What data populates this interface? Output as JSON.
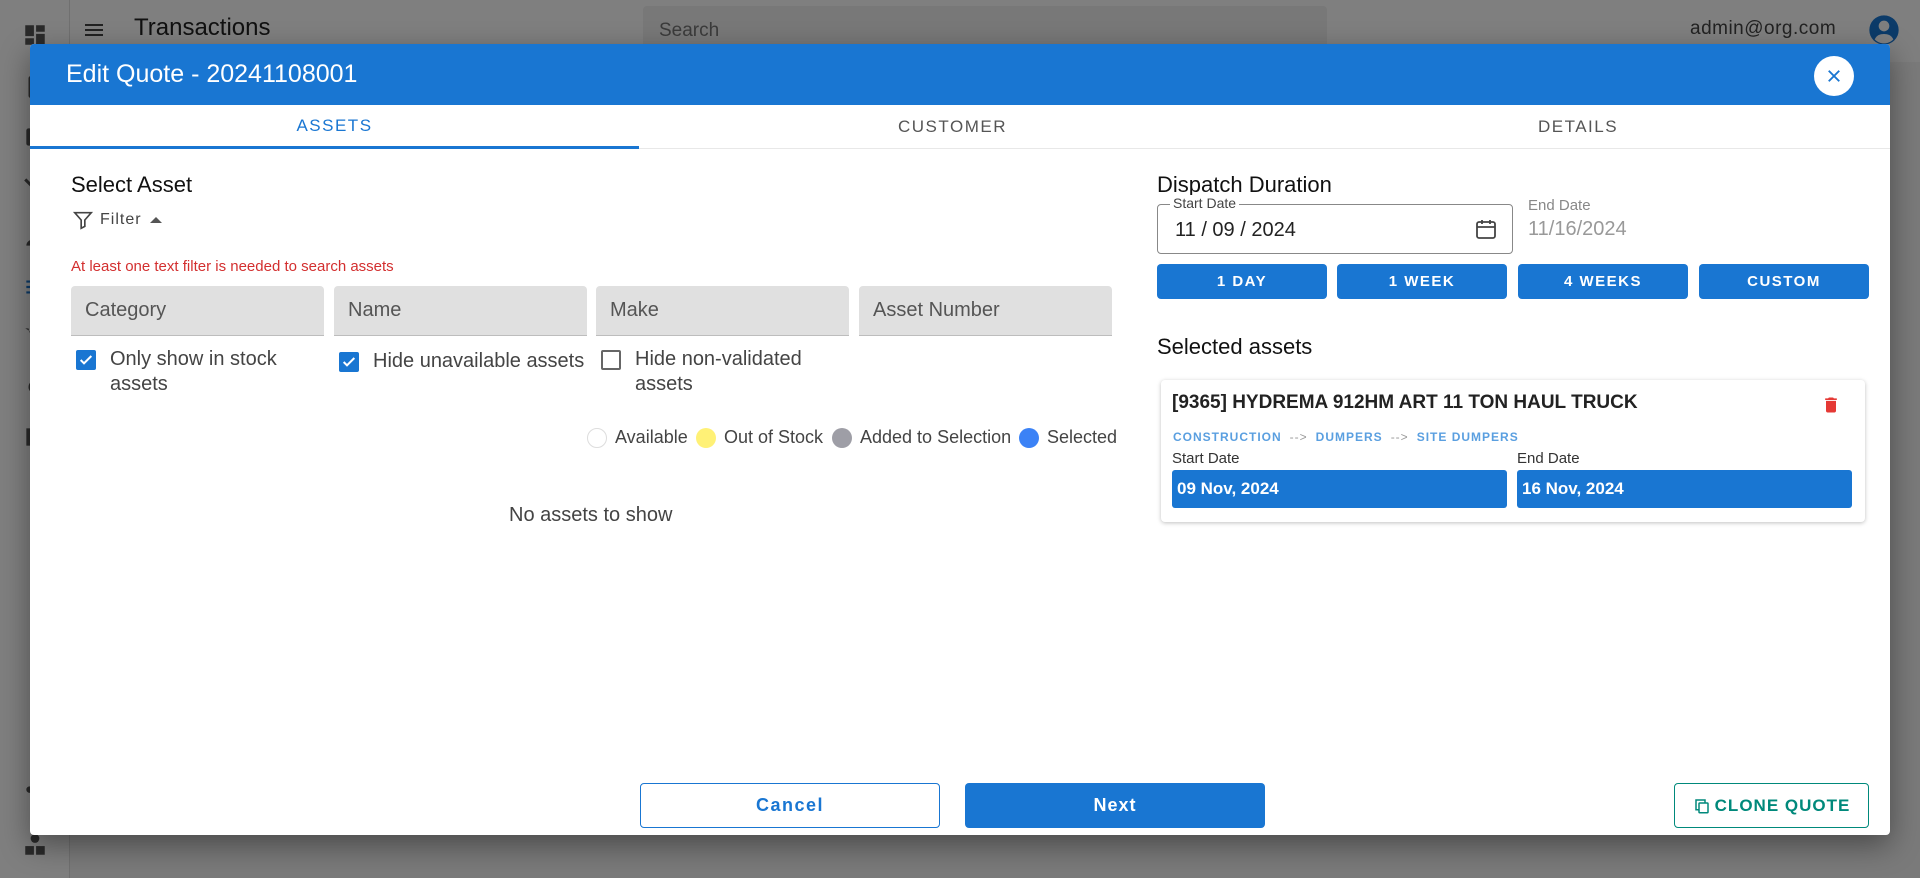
{
  "app": {
    "title": "Transactions",
    "search_placeholder": "Search",
    "user_email": "admin@org.com"
  },
  "dialog": {
    "title": "Edit Quote - 20241108001",
    "tabs": [
      {
        "label": "ASSETS",
        "active": true
      },
      {
        "label": "CUSTOMER",
        "active": false
      },
      {
        "label": "DETAILS",
        "active": false
      }
    ]
  },
  "select_asset": {
    "title": "Select Asset",
    "filter_label": "Filter",
    "warning": "At least one text filter is needed to search assets",
    "fields": [
      {
        "placeholder": "Category"
      },
      {
        "placeholder": "Name"
      },
      {
        "placeholder": "Make"
      },
      {
        "placeholder": "Asset Number"
      }
    ],
    "checkboxes": [
      {
        "line1": "Only show in stock",
        "line2": "assets",
        "checked": true
      },
      {
        "line1": "Hide unavailable assets",
        "line2": "",
        "checked": true
      },
      {
        "line1": "Hide non-validated",
        "line2": "assets",
        "checked": false
      }
    ],
    "legend": [
      {
        "label": "Available",
        "color": "#ffffff"
      },
      {
        "label": "Out of Stock",
        "color": "#fff176"
      },
      {
        "label": "Added to Selection",
        "color": "#9e9ea6"
      },
      {
        "label": "Selected",
        "color": "#3b82f6"
      }
    ],
    "empty_text": "No assets to show"
  },
  "dispatch": {
    "title": "Dispatch Duration",
    "start_label": "Start Date",
    "start_value": "11 / 09 / 2024",
    "end_label": "End Date",
    "end_value": "11/16/2024",
    "buttons": [
      "1 DAY",
      "1 WEEK",
      "4 WEEKS",
      "CUSTOM"
    ]
  },
  "selected_assets": {
    "title": "Selected assets",
    "items": [
      {
        "name": "[9365] HYDREMA 912HM ART 11 TON HAUL TRUCK",
        "path": [
          "CONSTRUCTION",
          "DUMPERS",
          "SITE DUMPERS"
        ],
        "separator": "-->",
        "start_label": "Start Date",
        "start": "09 Nov, 2024",
        "end_label": "End Date",
        "end": "16 Nov, 2024"
      }
    ]
  },
  "actions": {
    "cancel": "Cancel",
    "next": "Next",
    "clone": "CLONE QUOTE"
  },
  "colors": {
    "primary": "#1976d2",
    "clone": "#00897b",
    "warning": "#d32f2f"
  }
}
